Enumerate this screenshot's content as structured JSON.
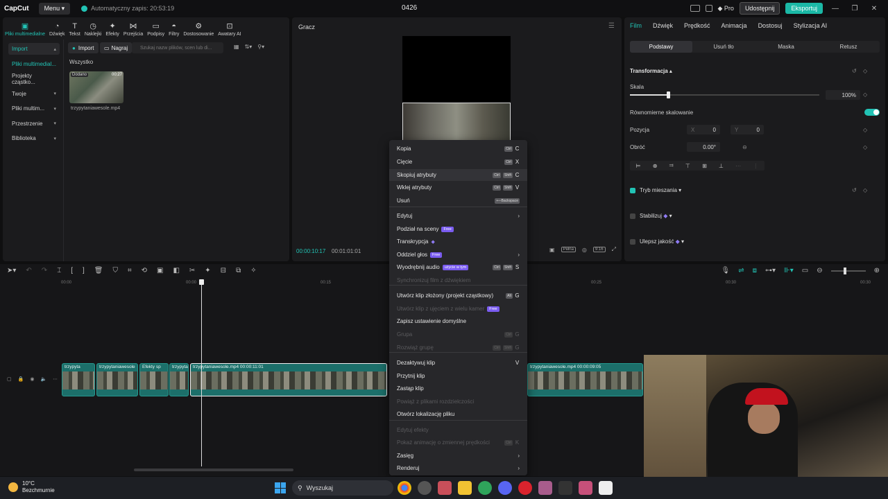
{
  "titlebar": {
    "logo": "CapCut",
    "menu": "Menu",
    "autosave": "Automatyczny zapis: 20:53:19",
    "project": "0426",
    "pro": "Pro",
    "share": "Udostępnij",
    "export": "Eksportuj"
  },
  "tools": [
    {
      "label": "Pliki multimedialne",
      "icon": "media-icon"
    },
    {
      "label": "Dźwięk",
      "icon": "audio-icon"
    },
    {
      "label": "Tekst",
      "icon": "text-icon"
    },
    {
      "label": "Naklejki",
      "icon": "sticker-icon"
    },
    {
      "label": "Efekty",
      "icon": "effects-icon"
    },
    {
      "label": "Przejścia",
      "icon": "transitions-icon"
    },
    {
      "label": "Podpisy",
      "icon": "captions-icon"
    },
    {
      "label": "Filtry",
      "icon": "filters-icon"
    },
    {
      "label": "Dostosowanie",
      "icon": "adjust-icon"
    },
    {
      "label": "Awatary AI",
      "icon": "avatar-icon"
    }
  ],
  "sidebar": {
    "items": [
      {
        "label": "Import"
      },
      {
        "label": "Pliki multimedial..."
      },
      {
        "label": "Projekty cząstko..."
      },
      {
        "label": "Twoje"
      },
      {
        "label": "Pliki multim..."
      },
      {
        "label": "Przestrzenie"
      },
      {
        "label": "Biblioteka"
      }
    ]
  },
  "media": {
    "import": "Import",
    "record": "Nagraj",
    "search_placeholder": "Szukaj nazw plików, scen lub di...",
    "section": "Wszystko",
    "thumb_badge": "Dodano",
    "thumb_duration": "00:27",
    "thumb_name": "trzypytaniawesole.mp4"
  },
  "player": {
    "title": "Gracz",
    "time_current": "00:00:10:17",
    "time_total": "00:01:01:01",
    "full_label": "Pełna",
    "ratio": "9:16"
  },
  "props": {
    "tabs": [
      "Film",
      "Dźwięk",
      "Prędkość",
      "Animacja",
      "Dostosuj",
      "Stylizacja AI"
    ],
    "sub_tabs": [
      "Podstawy",
      "Usuń tło",
      "Maska",
      "Retusz"
    ],
    "transform": "Transformacja",
    "scale_label": "Skala",
    "scale_value": "100%",
    "uniform": "Równomierne skalowanie",
    "position_label": "Pozycja",
    "pos_x_label": "X",
    "pos_x": "0",
    "pos_y_label": "Y",
    "pos_y": "0",
    "rotate_label": "Obróć",
    "rotate_value": "0.00°",
    "blend": "Tryb mieszania",
    "stabilize": "Stabilizuj",
    "enhance": "Ulepsz jakość"
  },
  "timeline": {
    "ruler": [
      "00:00",
      "00:00",
      "00:15",
      "00:20",
      "00:25",
      "00:30",
      "00:30"
    ],
    "clips": [
      {
        "label": "trzypyta"
      },
      {
        "label": "trzypytaniawesole"
      },
      {
        "label": "Efekty sp"
      },
      {
        "label": "trzypyta"
      },
      {
        "label": "trzypytaniawesole.mp4  00:00:11:01"
      },
      {
        "label": "trzypytaniawesole.mp4  00:00:09:05"
      }
    ]
  },
  "context_menu": {
    "items": [
      {
        "label": "Kopia",
        "mods": [
          "Ctrl"
        ],
        "key": "C"
      },
      {
        "label": "Cięcie",
        "mods": [
          "Ctrl"
        ],
        "key": "X"
      },
      {
        "label": "Skopiuj atrybuty",
        "mods": [
          "Ctrl",
          "Shift"
        ],
        "key": "C"
      },
      {
        "label": "Wklej atrybuty",
        "mods": [
          "Ctrl",
          "Shift"
        ],
        "key": "V"
      },
      {
        "label": "Usuń",
        "mods": [
          "⟵Backspace"
        ],
        "key": ""
      },
      {
        "label": "Edytuj"
      },
      {
        "label": "Podział na sceny",
        "tag": "Free"
      },
      {
        "label": "Transkrypcja"
      },
      {
        "label": "Oddziel głos",
        "tag": "Free"
      },
      {
        "label": "Wyodrębnij audio",
        "tag": "użycie w tym",
        "mods": [
          "Ctrl",
          "Shift"
        ],
        "key": "S"
      },
      {
        "label": "Synchronizuj film z dźwiękiem"
      },
      {
        "label": "Utwórz klip złożony (projekt cząstkowy)",
        "mods": [
          "Alt"
        ],
        "key": "G"
      },
      {
        "label": "Utwórz klip z ujęciem z wielu kamer",
        "tag": "Free"
      },
      {
        "label": "Zapisz ustawienie domyślne"
      },
      {
        "label": "Grupa",
        "mods": [
          "Ctrl"
        ],
        "key": "G"
      },
      {
        "label": "Rozwiąż grupę",
        "mods": [
          "Ctrl",
          "Shift"
        ],
        "key": "G"
      },
      {
        "label": "Dezaktywuj klip",
        "key": "V"
      },
      {
        "label": "Przytnij klip"
      },
      {
        "label": "Zastąp klip"
      },
      {
        "label": "Powiąż z plikami rozdzielczości"
      },
      {
        "label": "Otwórz lokalizację pliku"
      },
      {
        "label": "Edytuj efekty"
      },
      {
        "label": "Pokaż animację o zmiennej prędkości",
        "mods": [
          "Ctrl"
        ],
        "key": "K"
      },
      {
        "label": "Zasięg"
      },
      {
        "label": "Renderuj"
      }
    ]
  },
  "taskbar": {
    "temp": "10°C",
    "weather": "Bezchmurnie",
    "search": "Wyszukaj"
  },
  "colors": {
    "accent": "#22c3b5",
    "premium": "#7a5cf0",
    "clip": "#1c6f6a"
  }
}
